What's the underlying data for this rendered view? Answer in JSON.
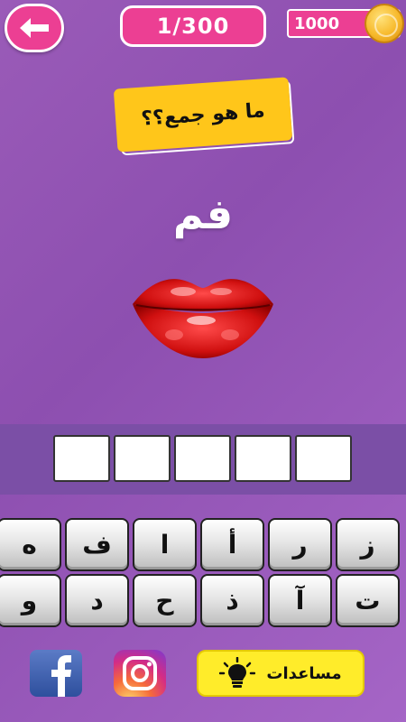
{
  "header": {
    "level": "1/300",
    "coins": "1000"
  },
  "question": "ما هو جمع؟؟",
  "word": "فم",
  "answer_slots": 5,
  "keyboard": {
    "row1": [
      "ه",
      "ف",
      "ا",
      "أ",
      "ر",
      "ز"
    ],
    "row2": [
      "و",
      "د",
      "ح",
      "ذ",
      "آ",
      "ت"
    ]
  },
  "footer": {
    "help_label": "مساعدات"
  },
  "colors": {
    "accent": "#ec3f93",
    "question_bg": "#ffc61a",
    "help_bg": "#ffec2a",
    "background": "#9a5bb8"
  },
  "icons": [
    "back-arrow-icon",
    "coin-icon",
    "lips-image",
    "facebook-icon",
    "instagram-icon",
    "lightbulb-icon"
  ]
}
